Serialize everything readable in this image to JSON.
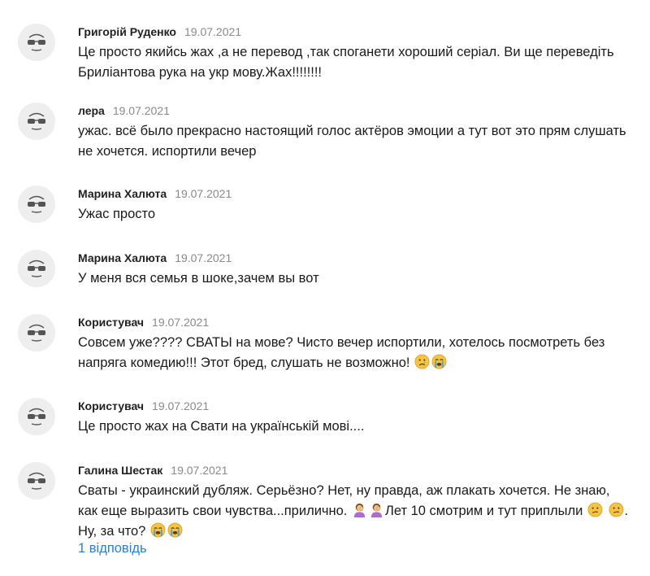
{
  "comments": [
    {
      "author": "Григорій Руденко",
      "date": "19.07.2021",
      "text": "Це просто якийсь жах ,а не перевод ,так споганети хороший серіал. Ви ще переведіть Бриліантова рука на укр мову.Жах!!!!!!!!"
    },
    {
      "author": "лера",
      "date": "19.07.2021",
      "text": "ужас. всё было прекрасно настоящий голос актёров эмоции а тут вот это прям слушать не хочется. испортили вечер"
    },
    {
      "author": "Марина Халюта",
      "date": "19.07.2021",
      "text": "Ужас просто"
    },
    {
      "author": "Марина Халюта",
      "date": "19.07.2021",
      "text": "У меня вся семья в шоке,зачем вы вот"
    },
    {
      "author": "Користувач",
      "date": "19.07.2021",
      "text": "Совсем уже???? СВАТЫ на мове? Чисто вечер испортили, хотелось посмотреть без напряга комедию!!! Этот бред, слушать не возможно!",
      "emojis": [
        "crying-face-icon",
        "loudly-crying-face-icon"
      ]
    },
    {
      "author": "Користувач",
      "date": "19.07.2021",
      "text": "Це просто жах на Свати на українській мові...."
    },
    {
      "author": "Галина Шестак",
      "date": "19.07.2021",
      "text_part1": "Сваты - украинский дубляж. Серьёзно? Нет, ну правда, аж плакать хочется. Не знаю, как еще выразить свои чувства...прилично.",
      "text_part2": "Лет 10 смотрим и тут приплыли",
      "text_part3": ". Ну, за что?",
      "emojis_after_part1": [
        "person-facepalming-icon",
        "person-facepalming-icon"
      ],
      "emojis_after_part2": [
        "confused-face-icon",
        "confused-face-icon"
      ],
      "emojis_after_part3": [
        "loudly-crying-face-icon",
        "loudly-crying-face-icon"
      ],
      "replies_label": "1 відповідь"
    }
  ],
  "colors": {
    "author": "#222222",
    "date": "#8a8a8a",
    "text": "#1a1a1a",
    "link": "#2b7fd4",
    "avatar_bg": "#eeeeee"
  }
}
